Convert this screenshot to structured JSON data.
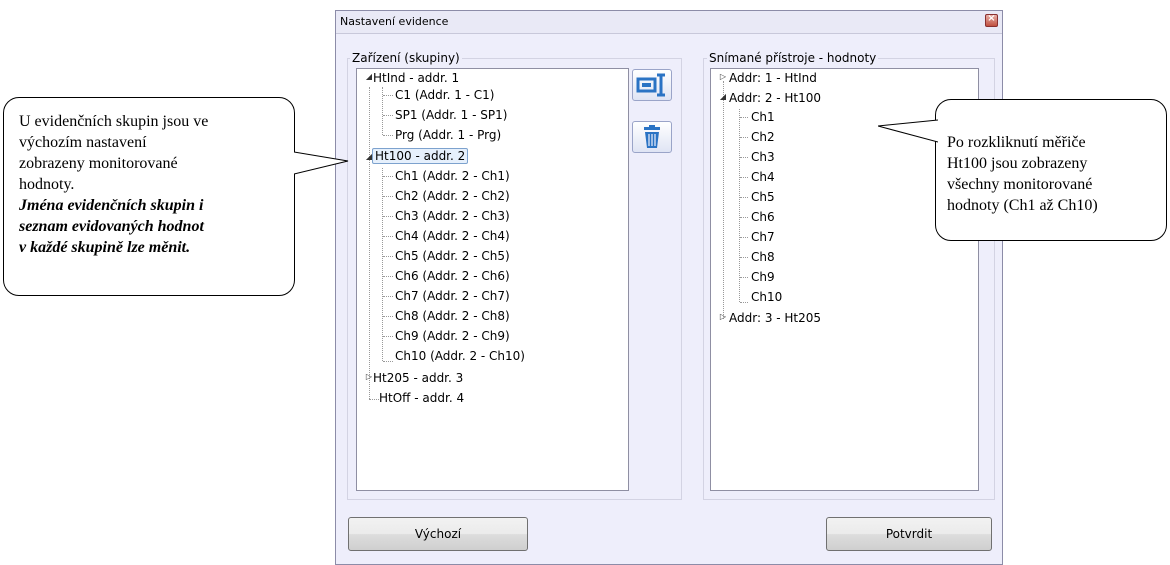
{
  "dialog": {
    "title": "Nastavení evidence",
    "left_group_label": "Zařízení (skupiny)",
    "right_group_label": "Snímané přístroje - hodnoty",
    "left_tree": {
      "htind": "HtInd - addr. 1",
      "htind_children": [
        "C1 (Addr. 1 - C1)",
        "SP1 (Addr. 1 - SP1)",
        "Prg (Addr. 1 - Prg)"
      ],
      "ht100": "Ht100 - addr. 2",
      "ht100_children": [
        "Ch1 (Addr. 2 - Ch1)",
        "Ch2 (Addr. 2 - Ch2)",
        "Ch3 (Addr. 2 - Ch3)",
        "Ch4 (Addr. 2 - Ch4)",
        "Ch5 (Addr. 2 - Ch5)",
        "Ch6 (Addr. 2 - Ch6)",
        "Ch7 (Addr. 2 - Ch7)",
        "Ch8 (Addr. 2 - Ch8)",
        "Ch9 (Addr. 2 - Ch9)",
        "Ch10 (Addr. 2 - Ch10)"
      ],
      "ht205": "Ht205 - addr. 3",
      "htoff": "HtOff - addr. 4"
    },
    "right_tree": {
      "addr1": "Addr: 1 - HtInd",
      "addr2": "Addr: 2 - Ht100",
      "addr2_children": [
        "Ch1",
        "Ch2",
        "Ch3",
        "Ch4",
        "Ch5",
        "Ch6",
        "Ch7",
        "Ch8",
        "Ch9",
        "Ch10"
      ],
      "addr3": "Addr: 3 - Ht205"
    },
    "default_button": "Výchozí",
    "confirm_button": "Potvrdit",
    "icons": [
      "edit-icon",
      "trash-icon",
      "close-icon"
    ]
  },
  "left_callout": {
    "text_lines": [
      "U evidenčních skupin jsou ve",
      "výchozím nastavení",
      "zobrazeny monitorované",
      "hodnoty."
    ],
    "bold_lines": [
      "Jména evidenčních skupin i",
      "seznam evidovaných hodnot",
      "v každé skupině lze měnit."
    ]
  },
  "right_callout": {
    "text_lines": [
      "Po rozkliknutí měřiče",
      "Ht100 jsou zobrazeny",
      "všechny monitorované",
      "hodnoty (Ch1 až Ch10)"
    ]
  }
}
